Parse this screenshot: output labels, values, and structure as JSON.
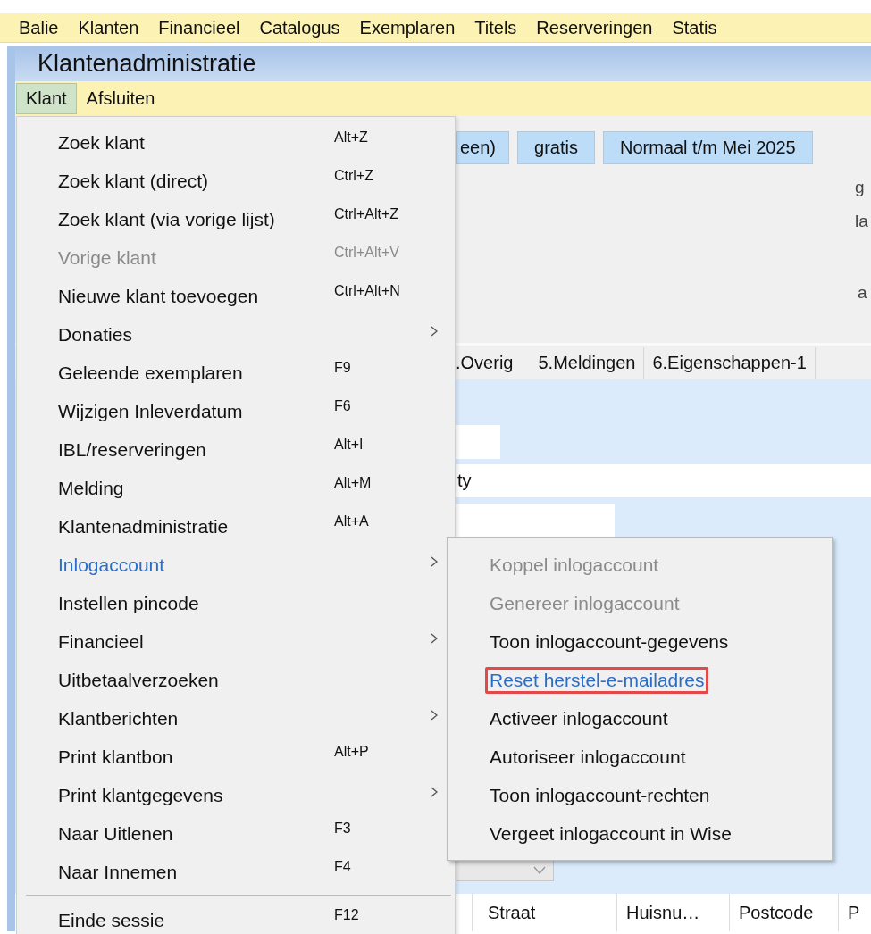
{
  "menubar": {
    "items": [
      "Balie",
      "Klanten",
      "Financieel",
      "Catalogus",
      "Exemplaren",
      "Titels",
      "Reserveringen",
      "Statis"
    ]
  },
  "window": {
    "title": "Klantenadministratie",
    "menu": [
      {
        "label": "Klant",
        "selected": true
      },
      {
        "label": "Afsluiten",
        "selected": false
      }
    ]
  },
  "badges": [
    "een)",
    "gratis",
    "Normaal t/m Mei 2025"
  ],
  "side_labels": [
    "g",
    "la",
    "a"
  ],
  "tabs": [
    ".Overig",
    "5.Meldingen",
    "6.Eigenschappen-1"
  ],
  "form": {
    "row_value": "ty"
  },
  "table": {
    "columns": [
      "Straat",
      "Huisnu…",
      "Postcode",
      "P"
    ]
  },
  "menu": {
    "items": [
      {
        "kind": "item",
        "label": "Zoek klant",
        "shortcut": "Alt+Z",
        "disabled": false,
        "highlighted": false,
        "submenu": false
      },
      {
        "kind": "item",
        "label": "Zoek klant (direct)",
        "shortcut": "Ctrl+Z",
        "disabled": false,
        "highlighted": false,
        "submenu": false
      },
      {
        "kind": "item",
        "label": "Zoek klant (via vorige lijst)",
        "shortcut": "Ctrl+Alt+Z",
        "disabled": false,
        "highlighted": false,
        "submenu": false
      },
      {
        "kind": "item",
        "label": "Vorige klant",
        "shortcut": "Ctrl+Alt+V",
        "disabled": true,
        "highlighted": false,
        "submenu": false
      },
      {
        "kind": "item",
        "label": "Nieuwe klant toevoegen",
        "shortcut": "Ctrl+Alt+N",
        "disabled": false,
        "highlighted": false,
        "submenu": false
      },
      {
        "kind": "item",
        "label": "Donaties",
        "disabled": false,
        "highlighted": false,
        "submenu": true
      },
      {
        "kind": "item",
        "label": "Geleende exemplaren",
        "shortcut": "F9",
        "disabled": false,
        "highlighted": false,
        "submenu": false
      },
      {
        "kind": "item",
        "label": "Wijzigen Inleverdatum",
        "shortcut": "F6",
        "disabled": false,
        "highlighted": false,
        "submenu": false
      },
      {
        "kind": "item",
        "label": "IBL/reserveringen",
        "shortcut": "Alt+I",
        "disabled": false,
        "highlighted": false,
        "submenu": false
      },
      {
        "kind": "item",
        "label": "Melding",
        "shortcut": "Alt+M",
        "disabled": false,
        "highlighted": false,
        "submenu": false
      },
      {
        "kind": "item",
        "label": "Klantenadministratie",
        "shortcut": "Alt+A",
        "disabled": false,
        "highlighted": false,
        "submenu": false
      },
      {
        "kind": "item",
        "label": "Inlogaccount",
        "disabled": false,
        "highlighted": true,
        "submenu": true
      },
      {
        "kind": "item",
        "label": "Instellen pincode",
        "disabled": false,
        "highlighted": false,
        "submenu": false
      },
      {
        "kind": "item",
        "label": "Financieel",
        "disabled": false,
        "highlighted": false,
        "submenu": true
      },
      {
        "kind": "item",
        "label": "Uitbetaalverzoeken",
        "disabled": false,
        "highlighted": false,
        "submenu": false
      },
      {
        "kind": "item",
        "label": "Klantberichten",
        "disabled": false,
        "highlighted": false,
        "submenu": true
      },
      {
        "kind": "item",
        "label": "Print klantbon",
        "shortcut": "Alt+P",
        "disabled": false,
        "highlighted": false,
        "submenu": false
      },
      {
        "kind": "item",
        "label": "Print klantgegevens",
        "disabled": false,
        "highlighted": false,
        "submenu": true
      },
      {
        "kind": "item",
        "label": "Naar Uitlenen",
        "shortcut": "F3",
        "disabled": false,
        "highlighted": false,
        "submenu": false
      },
      {
        "kind": "item",
        "label": "Naar Innemen",
        "shortcut": "F4",
        "disabled": false,
        "highlighted": false,
        "submenu": false
      },
      {
        "kind": "separator"
      },
      {
        "kind": "item",
        "label": "Einde sessie",
        "shortcut": "F12",
        "disabled": false,
        "highlighted": false,
        "submenu": false
      }
    ]
  },
  "submenu": {
    "items": [
      {
        "label": "Koppel inlogaccount",
        "disabled": true,
        "highlighted": false,
        "outlined": false
      },
      {
        "label": "Genereer inlogaccount",
        "disabled": true,
        "highlighted": false,
        "outlined": false
      },
      {
        "label": "Toon inlogaccount-gegevens",
        "disabled": false,
        "highlighted": false,
        "outlined": false
      },
      {
        "label": "Reset herstel-e-mailadres",
        "disabled": false,
        "highlighted": true,
        "outlined": true
      },
      {
        "label": "Activeer inlogaccount",
        "disabled": false,
        "highlighted": false,
        "outlined": false
      },
      {
        "label": "Autoriseer inlogaccount",
        "disabled": false,
        "highlighted": false,
        "outlined": false
      },
      {
        "label": "Toon inlogaccount-rechten",
        "disabled": false,
        "highlighted": false,
        "outlined": false
      },
      {
        "label": "Vergeet inlogaccount in Wise",
        "disabled": false,
        "highlighted": false,
        "outlined": false
      }
    ]
  }
}
